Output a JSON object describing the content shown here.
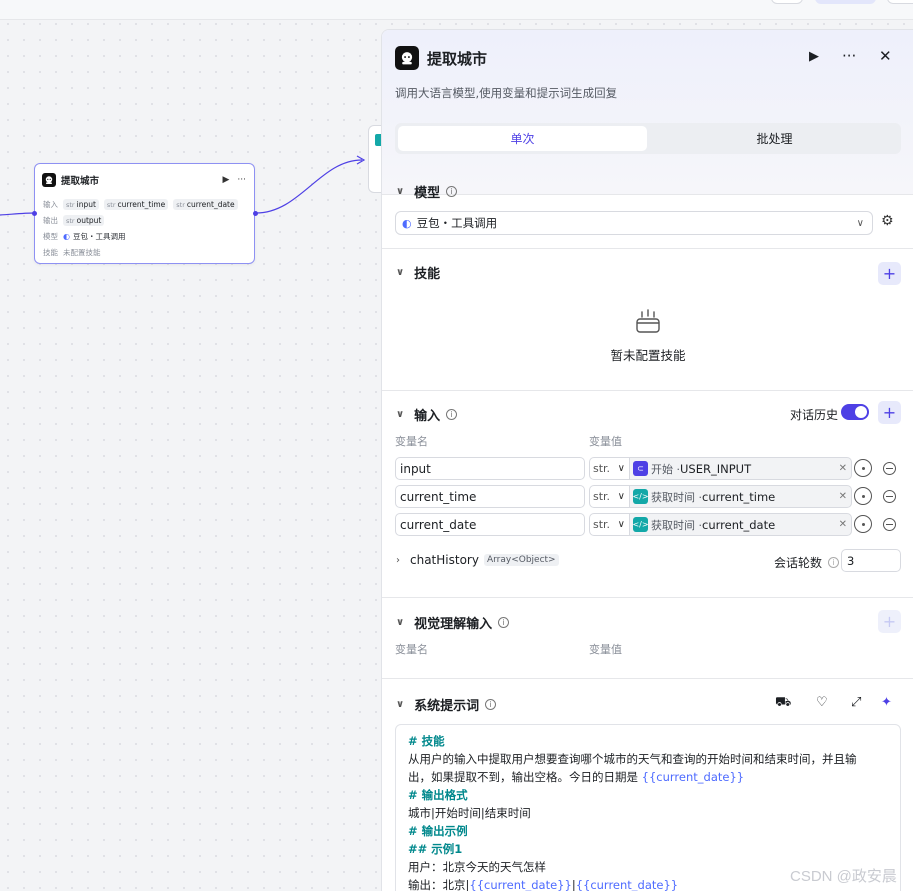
{
  "node": {
    "title": "提取城市",
    "run_icon": "▶",
    "more_icon": "···",
    "input_label": "输入",
    "inputs": [
      {
        "type": "str",
        "name": "input"
      },
      {
        "type": "str",
        "name": "current_time"
      },
      {
        "type": "str",
        "name": "current_date"
      }
    ],
    "output_label": "输出",
    "output": {
      "type": "str",
      "name": "output"
    },
    "model_label": "模型",
    "model": "豆包・工具调用",
    "skill_label": "技能",
    "skill_value": "未配置技能"
  },
  "panel": {
    "title": "提取城市",
    "description": "调用大语言模型,使用变量和提示词生成回复",
    "tabs": [
      "单次",
      "批处理"
    ],
    "model_section": {
      "title": "模型",
      "selected": "豆包・工具调用"
    },
    "skills_section": {
      "title": "技能",
      "empty": "暂未配置技能"
    },
    "input_section": {
      "title": "输入",
      "history_label": "对话历史",
      "history_enabled": true,
      "col_name": "变量名",
      "col_value": "变量值",
      "rows": [
        {
          "name": "input",
          "type": "str.",
          "source": "开始 · ",
          "var": "USER_INPUT",
          "color": "#4e40e5",
          "badge": "⊂"
        },
        {
          "name": "current_time",
          "type": "str.",
          "source": "获取时间 · ",
          "var": "current_time",
          "color": "#13a8a8",
          "badge": "</>"
        },
        {
          "name": "current_date",
          "type": "str.",
          "source": "获取时间 · ",
          "var": "current_date",
          "color": "#13a8a8",
          "badge": "</>"
        }
      ],
      "chat_history": "chatHistory",
      "chat_history_type": "Array<Object>",
      "rounds_label": "会话轮数",
      "rounds_value": "3"
    },
    "vision_section": {
      "title": "视觉理解输入",
      "col_name": "变量名",
      "col_value": "变量值"
    },
    "prompt_section": {
      "title": "系统提示词",
      "lines": {
        "h1": "# 技能",
        "l1": "从用户的输入中提取用户想要查询哪个城市的天气和查询的开始时间和结束时间，并且输",
        "l2a": "出，如果提取不到，输出空格。今日的日期是 ",
        "l2v": "{{current_date}}",
        "h2": "# 输出格式",
        "l3": "城市|开始时间|结束时间",
        "h3": "# 输出示例",
        "h4": "## 示例1",
        "l4": "用户：北京今天的天气怎样",
        "l5a": "输出：北京|",
        "l5v1": "{{current_date}}",
        "l5s": "|",
        "l5v2": "{{current_date}}"
      }
    }
  },
  "watermark": "CSDN @政安晨"
}
